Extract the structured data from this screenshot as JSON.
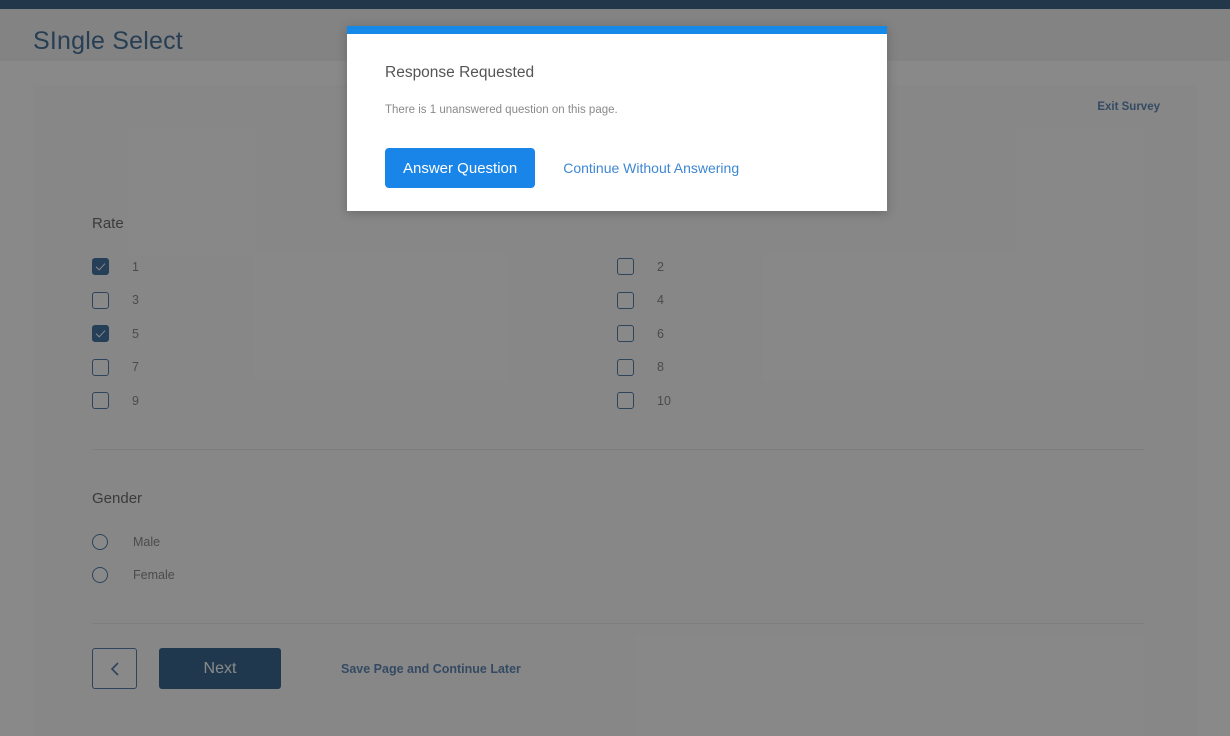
{
  "header": {
    "title": "SIngle Select"
  },
  "survey": {
    "exit_link": "Exit Survey",
    "questions": [
      {
        "title": "Rate",
        "type": "checkbox",
        "left_column": [
          {
            "label": "1",
            "checked": true
          },
          {
            "label": "3",
            "checked": false
          },
          {
            "label": "5",
            "checked": true
          },
          {
            "label": "7",
            "checked": false
          },
          {
            "label": "9",
            "checked": false
          }
        ],
        "right_column": [
          {
            "label": "2",
            "checked": false
          },
          {
            "label": "4",
            "checked": false
          },
          {
            "label": "6",
            "checked": false
          },
          {
            "label": "8",
            "checked": false
          },
          {
            "label": "10",
            "checked": false
          }
        ]
      },
      {
        "title": "Gender",
        "type": "radio",
        "left_column": [
          {
            "label": "Male",
            "checked": false
          },
          {
            "label": "Female",
            "checked": false
          }
        ],
        "right_column": []
      }
    ],
    "footer": {
      "back_aria": "Back",
      "next_label": "Next",
      "save_link": "Save Page and Continue Later"
    }
  },
  "modal": {
    "title": "Response Requested",
    "message": "There is 1 unanswered question on this page.",
    "primary_button": "Answer Question",
    "secondary_link": "Continue Without Answering",
    "accent_color": "#1589e8"
  },
  "colors": {
    "top_bar": "#12436d",
    "header_title": "#1d5183",
    "link": "#3a6ea5",
    "next_button": "#0b4474",
    "checkbox_checked": "#18548f",
    "modal_button": "#1a85e8"
  }
}
